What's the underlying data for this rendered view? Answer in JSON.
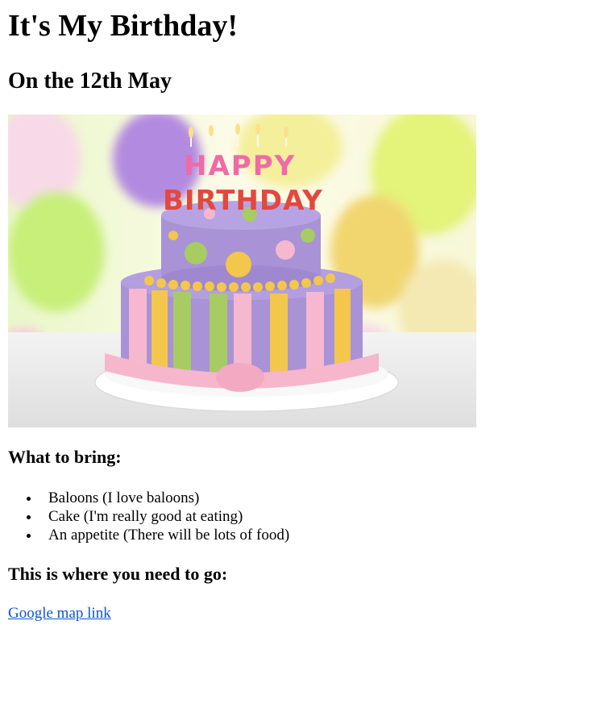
{
  "page": {
    "title": "It's My Birthday!",
    "date_heading": "On the 12th May",
    "bring_heading": "What to bring:",
    "bring_items": [
      "Baloons (I love baloons)",
      "Cake (I'm really good at eating)",
      "An appetite (There will be lots of food)"
    ],
    "where_heading": "This is where you need to go:",
    "map_link_text": "Google map link"
  },
  "image": {
    "alt": "Birthday cake with Happy Birthday candles and balloons",
    "candles_text_1": "HAPPY",
    "candles_text_2": "BIRTHDAY"
  },
  "colors": {
    "link": "#0b57d0",
    "cake_purple": "#a992d6",
    "cake_green": "#a6cc63",
    "cake_yellow": "#f2c74b",
    "cake_pink": "#f5b8cf"
  }
}
